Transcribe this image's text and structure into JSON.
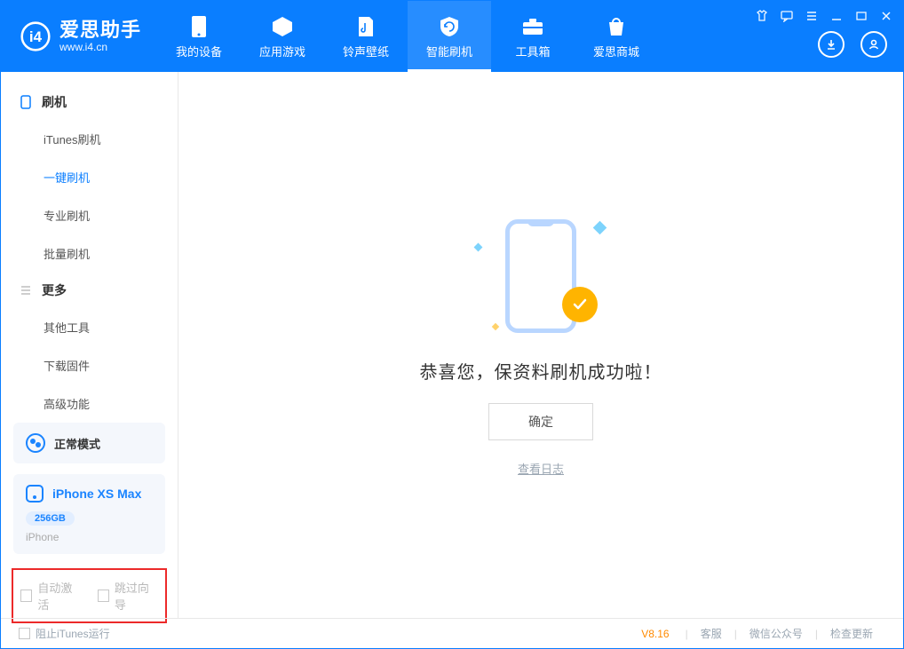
{
  "app": {
    "title": "爱思助手",
    "subtitle": "www.i4.cn"
  },
  "nav": {
    "items": [
      {
        "label": "我的设备"
      },
      {
        "label": "应用游戏"
      },
      {
        "label": "铃声壁纸"
      },
      {
        "label": "智能刷机"
      },
      {
        "label": "工具箱"
      },
      {
        "label": "爱思商城"
      }
    ]
  },
  "sidebar": {
    "section_flash": "刷机",
    "flash_items": [
      {
        "label": "iTunes刷机"
      },
      {
        "label": "一键刷机"
      },
      {
        "label": "专业刷机"
      },
      {
        "label": "批量刷机"
      }
    ],
    "section_more": "更多",
    "more_items": [
      {
        "label": "其他工具"
      },
      {
        "label": "下载固件"
      },
      {
        "label": "高级功能"
      }
    ],
    "mode_label": "正常模式",
    "device": {
      "name": "iPhone XS Max",
      "capacity": "256GB",
      "type": "iPhone"
    },
    "options": {
      "auto_activate": "自动激活",
      "skip_guide": "跳过向导"
    }
  },
  "main": {
    "success_text": "恭喜您，保资料刷机成功啦！",
    "ok_button": "确定",
    "view_log": "查看日志"
  },
  "footer": {
    "block_itunes": "阻止iTunes运行",
    "version": "V8.16",
    "links": {
      "service": "客服",
      "wechat": "微信公众号",
      "update": "检查更新"
    }
  }
}
